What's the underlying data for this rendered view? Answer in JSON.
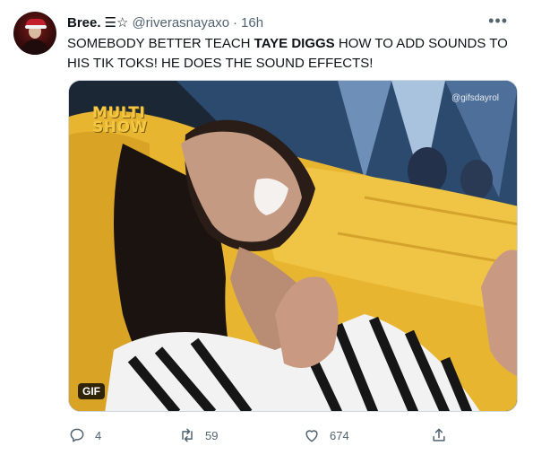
{
  "tweet": {
    "author": {
      "display_name": "Bree.",
      "name_emoji": "☰☆",
      "handle": "@riverasnayaxo",
      "separator": "·",
      "time": "16h",
      "avatar_icon": "profile-avatar"
    },
    "more_label": "•••",
    "text_before": "SOMEBODY BETTER TEACH ",
    "text_bold": "TAYE DIGGS",
    "text_after": " HOW TO ADD SOUNDS TO HIS TIK TOKS! HE DOES THE SOUND EFFECTS!",
    "media": {
      "watermark": "@gifsdayrol",
      "logo_line1": "MULTI",
      "logo_line2": "SHOW",
      "badge": "GIF"
    },
    "actions": {
      "reply_count": "4",
      "retweet_count": "59",
      "like_count": "674",
      "reply_icon": "reply-icon",
      "retweet_icon": "retweet-icon",
      "like_icon": "heart-icon",
      "share_icon": "share-icon"
    }
  },
  "colors": {
    "text": "#0f1419",
    "secondary": "#536471",
    "border": "#cfd9de",
    "logo_yellow": "#f4c842"
  }
}
